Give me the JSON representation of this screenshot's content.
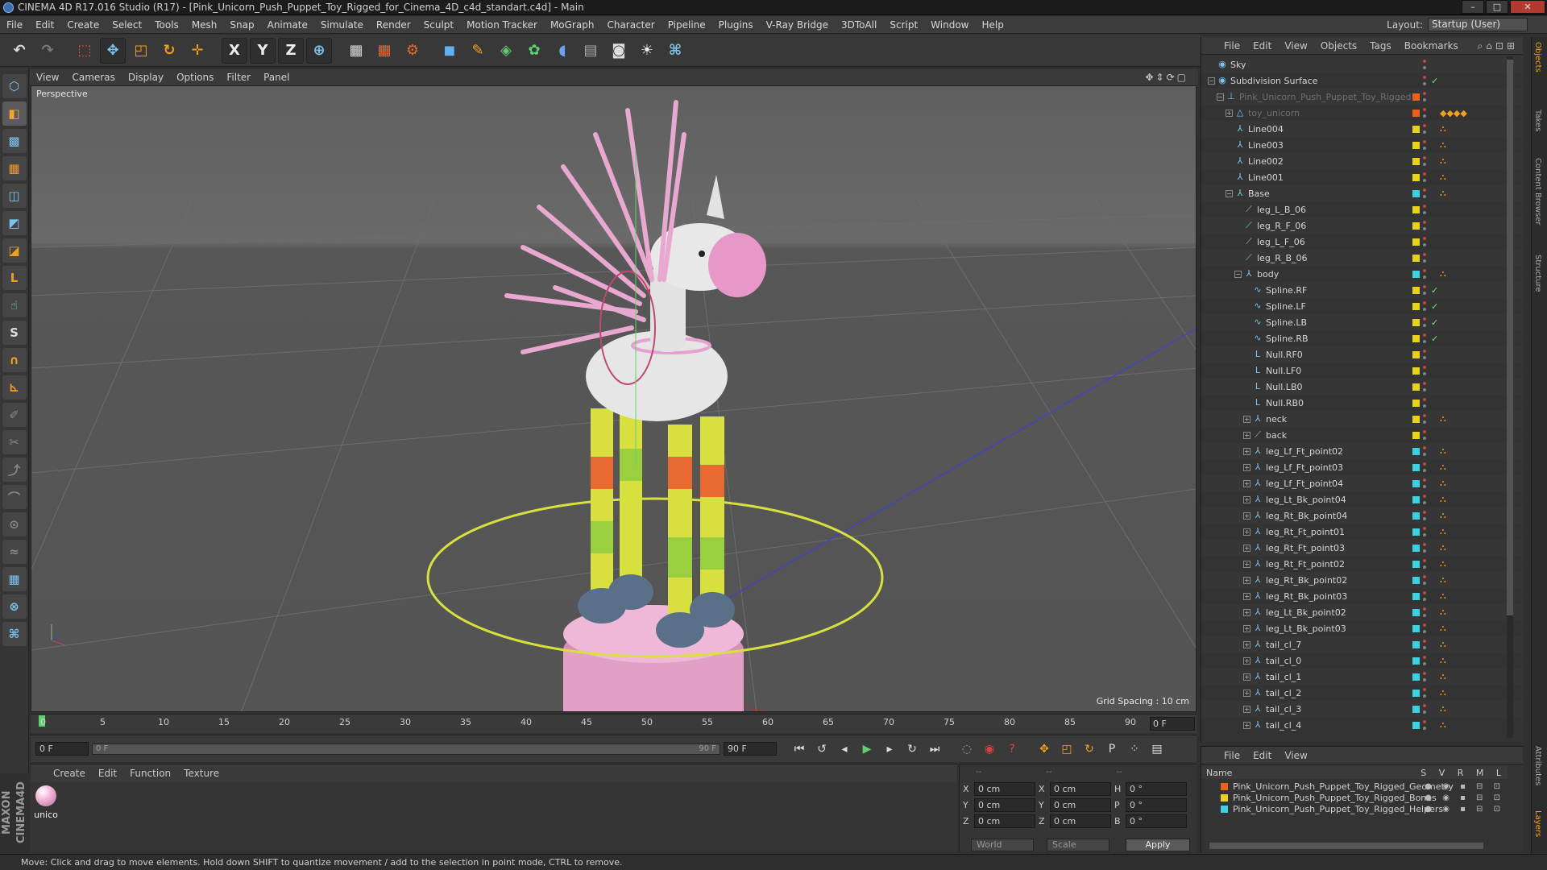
{
  "window": {
    "title": "CINEMA 4D R17.016 Studio (R17) - [Pink_Unicorn_Push_Puppet_Toy_Rigged_for_Cinema_4D_c4d_standart.c4d] - Main",
    "buttons": [
      "–",
      "□",
      "✕"
    ]
  },
  "menu": [
    "File",
    "Edit",
    "Create",
    "Select",
    "Tools",
    "Mesh",
    "Snap",
    "Animate",
    "Simulate",
    "Render",
    "Sculpt",
    "Motion Tracker",
    "MoGraph",
    "Character",
    "Pipeline",
    "Plugins",
    "V-Ray Bridge",
    "3DToAll",
    "Script",
    "Window",
    "Help"
  ],
  "layout": {
    "label": "Layout:",
    "value": "Startup (User)"
  },
  "toolbar": {
    "tools": [
      "undo-icon",
      "redo-icon",
      "live-select-icon",
      "move-icon",
      "scale-icon",
      "rotate-icon",
      "transform-icon",
      "x-axis-icon",
      "y-axis-icon",
      "z-axis-icon",
      "world-coord-icon",
      "render-view-icon",
      "render-picture-viewer-icon",
      "edit-render-settings-icon",
      "cube-icon",
      "pen-icon",
      "subdivision-icon",
      "array-icon",
      "deformer-icon",
      "floor-icon",
      "camera-icon",
      "light-icon",
      "python-icon"
    ],
    "axis_labels": [
      "X",
      "Y",
      "Z"
    ]
  },
  "lefttools": [
    "make-editable-icon",
    "model-mode-icon",
    "texture-mode-icon",
    "workplane-icon",
    "points-mode-icon",
    "edges-mode-icon",
    "polygons-mode-icon",
    "axis-mode-icon",
    "tweak-mode-icon",
    "solo-icon",
    "magnet-icon",
    "snap-icon",
    "brush-icon",
    "knife-icon",
    "extrude-icon",
    "bridge-icon",
    "weld-icon",
    "smooth-icon",
    "lock-workplane-icon",
    "quantize-icon",
    "python-console-icon"
  ],
  "viewport": {
    "menu": [
      "View",
      "Cameras",
      "Display",
      "Options",
      "Filter",
      "Panel"
    ],
    "label": "Perspective",
    "grid_spacing": "Grid Spacing : 10 cm"
  },
  "timeline": {
    "ticks": [
      "0",
      "5",
      "10",
      "15",
      "20",
      "25",
      "30",
      "35",
      "40",
      "45",
      "50",
      "55",
      "60",
      "65",
      "70",
      "75",
      "80",
      "85",
      "90"
    ],
    "current_frame": "0 F"
  },
  "transport": {
    "start": "0 F",
    "slider_left": "0 F",
    "slider_right": "90 F",
    "end": "90 F"
  },
  "material": {
    "menu": [
      "Create",
      "Edit",
      "Function",
      "Texture"
    ],
    "items": [
      {
        "name": "unico"
      }
    ]
  },
  "coords": {
    "rows": [
      {
        "a": "X",
        "av": "0 cm",
        "b": "X",
        "bv": "0 cm",
        "c": "H",
        "cv": "0 °"
      },
      {
        "a": "Y",
        "av": "0 cm",
        "b": "Y",
        "bv": "0 cm",
        "c": "P",
        "cv": "0 °"
      },
      {
        "a": "Z",
        "av": "0 cm",
        "b": "Z",
        "bv": "0 cm",
        "c": "B",
        "cv": "0 °"
      }
    ],
    "world": "World",
    "scale": "Scale",
    "apply": "Apply",
    "headers": [
      "--",
      "--",
      "--"
    ]
  },
  "objects": {
    "menu": [
      "File",
      "Edit",
      "View",
      "Objects",
      "Tags",
      "Bookmarks"
    ],
    "rows": [
      {
        "name": "Sky",
        "indent": 0,
        "icon": "◉",
        "exp": "",
        "layer": "",
        "dim": false,
        "chk": "",
        "tag": ""
      },
      {
        "name": "Subdivision Surface",
        "indent": 0,
        "icon": "◉",
        "exp": "−",
        "layer": "",
        "dim": false,
        "chk": "✓",
        "tag": ""
      },
      {
        "name": "Pink_Unicorn_Push_Puppet_Toy_Rigged",
        "indent": 1,
        "icon": "⊥",
        "exp": "−",
        "layer": "#e8641e",
        "dim": true,
        "chk": "",
        "tag": ""
      },
      {
        "name": "toy_unicorn",
        "indent": 2,
        "icon": "△",
        "exp": "+",
        "layer": "#e8641e",
        "dim": true,
        "chk": "",
        "tag": "◆◆◆◆"
      },
      {
        "name": "Line004",
        "indent": 2,
        "icon": "⅄",
        "exp": "",
        "layer": "#e8d21e",
        "dim": false,
        "chk": "",
        "tag": "⛬"
      },
      {
        "name": "Line003",
        "indent": 2,
        "icon": "⅄",
        "exp": "",
        "layer": "#e8d21e",
        "dim": false,
        "chk": "",
        "tag": "⛬"
      },
      {
        "name": "Line002",
        "indent": 2,
        "icon": "⅄",
        "exp": "",
        "layer": "#e8d21e",
        "dim": false,
        "chk": "",
        "tag": "⛬"
      },
      {
        "name": "Line001",
        "indent": 2,
        "icon": "⅄",
        "exp": "",
        "layer": "#e8d21e",
        "dim": false,
        "chk": "",
        "tag": "⛬"
      },
      {
        "name": "Base",
        "indent": 2,
        "icon": "⅄",
        "exp": "−",
        "layer": "#3ed0e0",
        "dim": false,
        "chk": "",
        "tag": "⛬"
      },
      {
        "name": "leg_L_B_06",
        "indent": 3,
        "icon": "⟋",
        "exp": "",
        "layer": "#e8d21e",
        "dim": false,
        "chk": "",
        "tag": ""
      },
      {
        "name": "leg_R_F_06",
        "indent": 3,
        "icon": "⟋",
        "exp": "",
        "layer": "#e8d21e",
        "dim": false,
        "chk": "",
        "tag": ""
      },
      {
        "name": "leg_L_F_06",
        "indent": 3,
        "icon": "⟋",
        "exp": "",
        "layer": "#e8d21e",
        "dim": false,
        "chk": "",
        "tag": ""
      },
      {
        "name": "leg_R_B_06",
        "indent": 3,
        "icon": "⟋",
        "exp": "",
        "layer": "#e8d21e",
        "dim": false,
        "chk": "",
        "tag": ""
      },
      {
        "name": "body",
        "indent": 3,
        "icon": "⅄",
        "exp": "−",
        "layer": "#3ed0e0",
        "dim": false,
        "chk": "",
        "tag": "⛬"
      },
      {
        "name": "Spline.RF",
        "indent": 4,
        "icon": "∿",
        "exp": "",
        "layer": "#e8d21e",
        "dim": false,
        "chk": "✓",
        "tag": ""
      },
      {
        "name": "Spline.LF",
        "indent": 4,
        "icon": "∿",
        "exp": "",
        "layer": "#e8d21e",
        "dim": false,
        "chk": "✓",
        "tag": ""
      },
      {
        "name": "Spline.LB",
        "indent": 4,
        "icon": "∿",
        "exp": "",
        "layer": "#e8d21e",
        "dim": false,
        "chk": "✓",
        "tag": ""
      },
      {
        "name": "Spline.RB",
        "indent": 4,
        "icon": "∿",
        "exp": "",
        "layer": "#e8d21e",
        "dim": false,
        "chk": "✓",
        "tag": ""
      },
      {
        "name": "Null.RF0",
        "indent": 4,
        "icon": "L",
        "exp": "",
        "layer": "#e8d21e",
        "dim": false,
        "chk": "",
        "tag": ""
      },
      {
        "name": "Null.LF0",
        "indent": 4,
        "icon": "L",
        "exp": "",
        "layer": "#e8d21e",
        "dim": false,
        "chk": "",
        "tag": ""
      },
      {
        "name": "Null.LB0",
        "indent": 4,
        "icon": "L",
        "exp": "",
        "layer": "#e8d21e",
        "dim": false,
        "chk": "",
        "tag": ""
      },
      {
        "name": "Null.RB0",
        "indent": 4,
        "icon": "L",
        "exp": "",
        "layer": "#e8d21e",
        "dim": false,
        "chk": "",
        "tag": ""
      },
      {
        "name": "neck",
        "indent": 4,
        "icon": "⅄",
        "exp": "+",
        "layer": "#e8d21e",
        "dim": false,
        "chk": "",
        "tag": "⛬"
      },
      {
        "name": "back",
        "indent": 4,
        "icon": "⟋",
        "exp": "+",
        "layer": "#e8d21e",
        "dim": false,
        "chk": "",
        "tag": ""
      },
      {
        "name": "leg_Lf_Ft_point02",
        "indent": 4,
        "icon": "⅄",
        "exp": "+",
        "layer": "#3ed0e0",
        "dim": false,
        "chk": "",
        "tag": "⛬"
      },
      {
        "name": "leg_Lf_Ft_point03",
        "indent": 4,
        "icon": "⅄",
        "exp": "+",
        "layer": "#3ed0e0",
        "dim": false,
        "chk": "",
        "tag": "⛬"
      },
      {
        "name": "leg_Lf_Ft_point04",
        "indent": 4,
        "icon": "⅄",
        "exp": "+",
        "layer": "#3ed0e0",
        "dim": false,
        "chk": "",
        "tag": "⛬"
      },
      {
        "name": "leg_Lt_Bk_point04",
        "indent": 4,
        "icon": "⅄",
        "exp": "+",
        "layer": "#3ed0e0",
        "dim": false,
        "chk": "",
        "tag": "⛬"
      },
      {
        "name": "leg_Rt_Bk_point04",
        "indent": 4,
        "icon": "⅄",
        "exp": "+",
        "layer": "#3ed0e0",
        "dim": false,
        "chk": "",
        "tag": "⛬"
      },
      {
        "name": "leg_Rt_Ft_point01",
        "indent": 4,
        "icon": "⅄",
        "exp": "+",
        "layer": "#3ed0e0",
        "dim": false,
        "chk": "",
        "tag": "⛬"
      },
      {
        "name": "leg_Rt_Ft_point03",
        "indent": 4,
        "icon": "⅄",
        "exp": "+",
        "layer": "#3ed0e0",
        "dim": false,
        "chk": "",
        "tag": "⛬"
      },
      {
        "name": "leg_Rt_Ft_point02",
        "indent": 4,
        "icon": "⅄",
        "exp": "+",
        "layer": "#3ed0e0",
        "dim": false,
        "chk": "",
        "tag": "⛬"
      },
      {
        "name": "leg_Rt_Bk_point02",
        "indent": 4,
        "icon": "⅄",
        "exp": "+",
        "layer": "#3ed0e0",
        "dim": false,
        "chk": "",
        "tag": "⛬"
      },
      {
        "name": "leg_Rt_Bk_point03",
        "indent": 4,
        "icon": "⅄",
        "exp": "+",
        "layer": "#3ed0e0",
        "dim": false,
        "chk": "",
        "tag": "⛬"
      },
      {
        "name": "leg_Lt_Bk_point02",
        "indent": 4,
        "icon": "⅄",
        "exp": "+",
        "layer": "#3ed0e0",
        "dim": false,
        "chk": "",
        "tag": "⛬"
      },
      {
        "name": "leg_Lt_Bk_point03",
        "indent": 4,
        "icon": "⅄",
        "exp": "+",
        "layer": "#3ed0e0",
        "dim": false,
        "chk": "",
        "tag": "⛬"
      },
      {
        "name": "tail_cl_7",
        "indent": 4,
        "icon": "⅄",
        "exp": "+",
        "layer": "#3ed0e0",
        "dim": false,
        "chk": "",
        "tag": "⛬"
      },
      {
        "name": "tail_cl_0",
        "indent": 4,
        "icon": "⅄",
        "exp": "+",
        "layer": "#3ed0e0",
        "dim": false,
        "chk": "",
        "tag": "⛬"
      },
      {
        "name": "tail_cl_1",
        "indent": 4,
        "icon": "⅄",
        "exp": "+",
        "layer": "#3ed0e0",
        "dim": false,
        "chk": "",
        "tag": "⛬"
      },
      {
        "name": "tail_cl_2",
        "indent": 4,
        "icon": "⅄",
        "exp": "+",
        "layer": "#3ed0e0",
        "dim": false,
        "chk": "",
        "tag": "⛬"
      },
      {
        "name": "tail_cl_3",
        "indent": 4,
        "icon": "⅄",
        "exp": "+",
        "layer": "#3ed0e0",
        "dim": false,
        "chk": "",
        "tag": "⛬"
      },
      {
        "name": "tail_cl_4",
        "indent": 4,
        "icon": "⅄",
        "exp": "+",
        "layer": "#3ed0e0",
        "dim": false,
        "chk": "",
        "tag": "⛬"
      }
    ]
  },
  "layers": {
    "menu": [
      "File",
      "Edit",
      "View"
    ],
    "header": "Name",
    "cols": "S V R M L",
    "rows": [
      {
        "name": "Pink_Unicorn_Push_Puppet_Toy_Rigged_Geometry",
        "color": "#e8641e"
      },
      {
        "name": "Pink_Unicorn_Push_Puppet_Toy_Rigged_Bones",
        "color": "#e8d21e"
      },
      {
        "name": "Pink_Unicorn_Push_Puppet_Toy_Rigged_Helpers",
        "color": "#3ed0e0"
      }
    ]
  },
  "sidetabs": [
    "Objects",
    "Takes",
    "Content Browser",
    "Structure",
    "Attributes",
    "Layers"
  ],
  "status": "Move: Click and drag to move elements. Hold down SHIFT to quantize movement / add to the selection in point mode, CTRL to remove.",
  "colors": {
    "accent": "#7cc4ef",
    "orange": "#f0a020",
    "mane_pink": "#e8a8d0",
    "body_white": "#e8e8e8",
    "base_pink": "#e8a0c8",
    "ring_yellow": "#d8e040"
  }
}
